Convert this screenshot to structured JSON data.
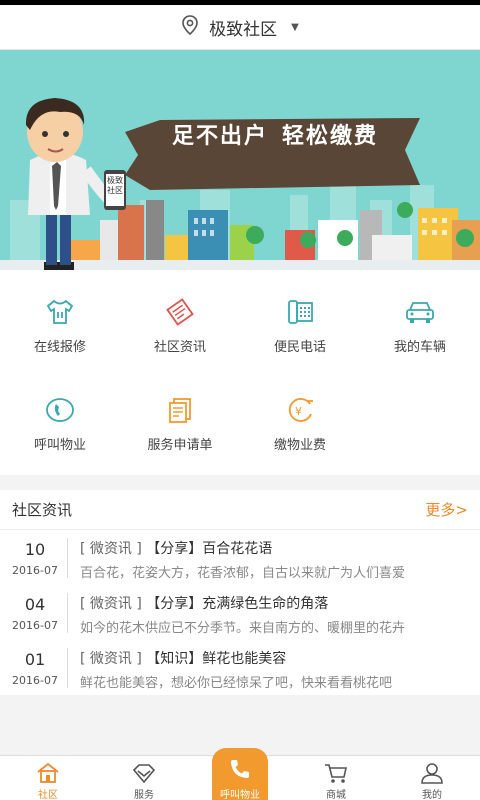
{
  "header": {
    "location": "极致社区"
  },
  "banner": {
    "slogan_left": "足不出户",
    "slogan_right": "轻松缴费",
    "phone_text_line1": "极致",
    "phone_text_line2": "社区"
  },
  "services": [
    {
      "label": "在线报修",
      "icon": "repair-shirt-icon"
    },
    {
      "label": "社区资讯",
      "icon": "news-icon"
    },
    {
      "label": "便民电话",
      "icon": "phonebook-icon"
    },
    {
      "label": "我的车辆",
      "icon": "car-icon"
    },
    {
      "label": "呼叫物业",
      "icon": "phone-call-icon"
    },
    {
      "label": "服务申请单",
      "icon": "form-icon"
    },
    {
      "label": "缴物业费",
      "icon": "yen-payment-icon"
    }
  ],
  "news": {
    "title": "社区资讯",
    "more": "更多>",
    "items": [
      {
        "day": "10",
        "ym": "2016-07",
        "category": "[ 微资讯 ]",
        "tag": "【分享】",
        "title": "百合花花语",
        "summary": "百合花，花姿大方，花香浓郁，自古以来就广为人们喜爱"
      },
      {
        "day": "04",
        "ym": "2016-07",
        "category": "[ 微资讯 ]",
        "tag": "【分享】",
        "title": "充满绿色生命的角落",
        "summary": "如今的花木供应已不分季节。来自南方的、暖棚里的花卉"
      },
      {
        "day": "01",
        "ym": "2016-07",
        "category": "[ 微资讯 ]",
        "tag": "【知识】",
        "title": "鲜花也能美容",
        "summary": "鲜花也能美容，想必你已经惊呆了吧，快来看看桃花吧"
      }
    ]
  },
  "tabs": [
    {
      "label": "社区",
      "icon": "home-icon",
      "active": true
    },
    {
      "label": "服务",
      "icon": "diamond-icon",
      "active": false
    },
    {
      "label": "呼叫物业",
      "icon": "phone-icon",
      "active": false
    },
    {
      "label": "商城",
      "icon": "cart-icon",
      "active": false
    },
    {
      "label": "我的",
      "icon": "user-icon",
      "active": false
    }
  ],
  "colors": {
    "accent": "#f39a2e",
    "accent_text": "#ef8a2a",
    "teal": "#3aa8b0",
    "banner_sky": "#7fd6d0"
  }
}
